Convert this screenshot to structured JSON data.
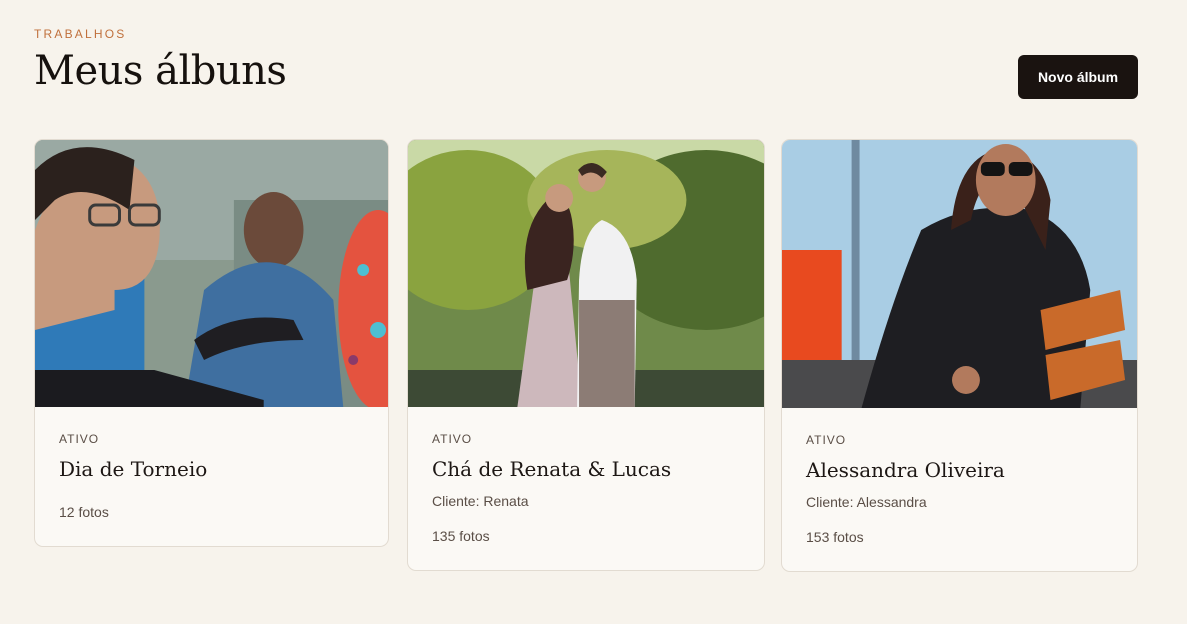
{
  "header": {
    "eyebrow": "TRABALHOS",
    "title": "Meus álbuns",
    "new_album_label": "Novo álbum"
  },
  "albums": [
    {
      "status": "ATIVO",
      "title": "Dia de Torneio",
      "client": "",
      "count": "12 fotos"
    },
    {
      "status": "ATIVO",
      "title": "Chá de Renata & Lucas",
      "client": "Cliente: Renata",
      "count": "135 fotos"
    },
    {
      "status": "ATIVO",
      "title": "Alessandra Oliveira",
      "client": "Cliente: Alessandra",
      "count": "153 fotos"
    }
  ],
  "colors": {
    "background": "#f7f3ec",
    "accent": "#c0703c",
    "button": "#1a1310",
    "card": "#fbf9f5"
  }
}
